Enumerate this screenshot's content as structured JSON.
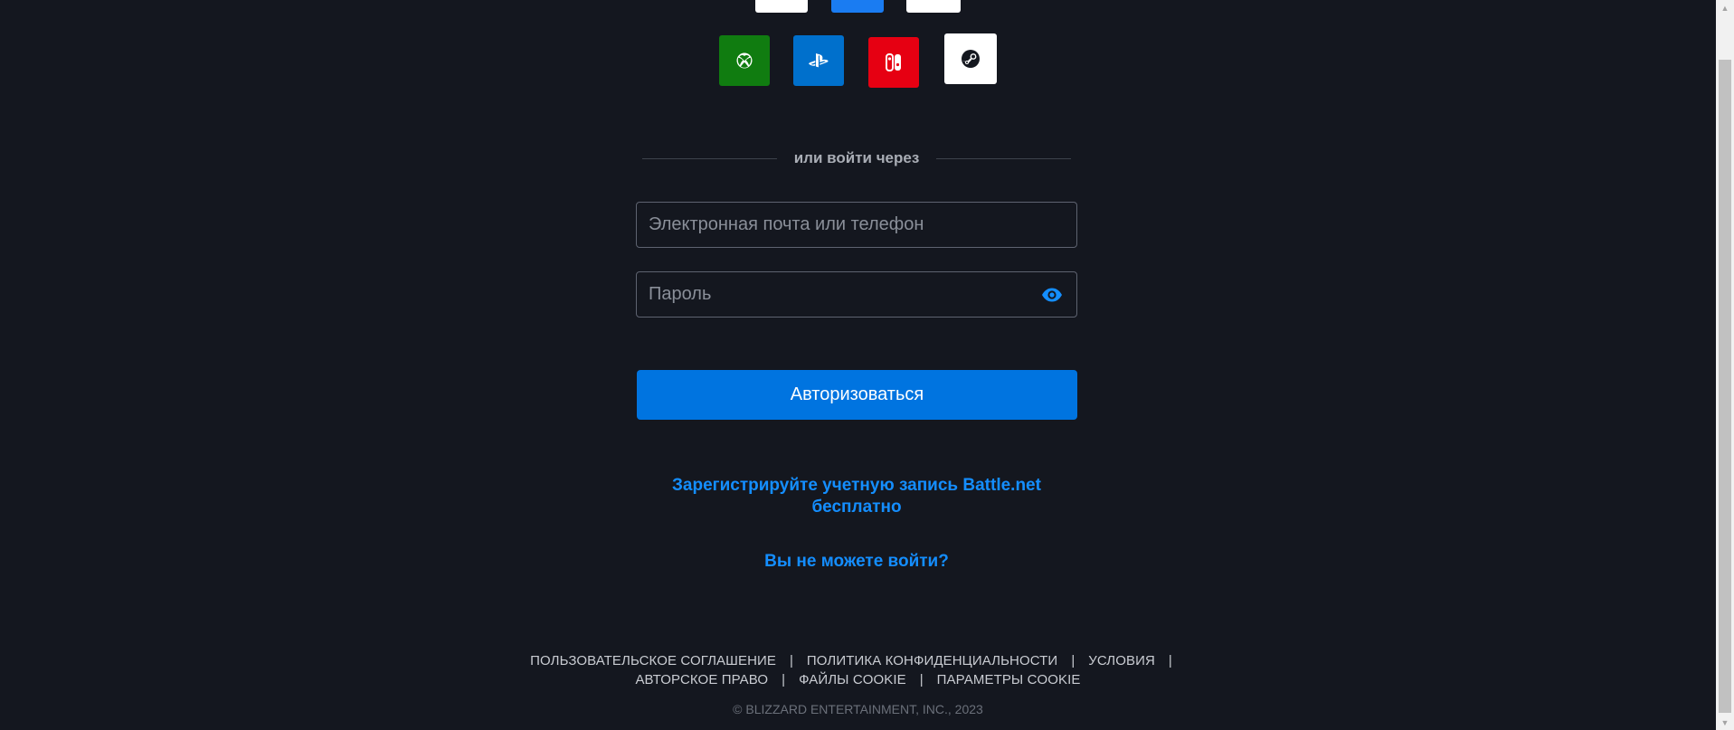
{
  "console_logins": {
    "xbox": {
      "icon": "xbox-icon",
      "color": "#107c10"
    },
    "playstation": {
      "icon": "playstation-icon",
      "color": "#0070cc"
    },
    "nintendo": {
      "icon": "nintendo-switch-icon",
      "color": "#e60012"
    },
    "steam": {
      "icon": "steam-icon",
      "color": "#ffffff"
    }
  },
  "divider_text": "или войти через",
  "email_field": {
    "placeholder": "Электронная почта или телефон",
    "value": ""
  },
  "password_field": {
    "placeholder": "Пароль",
    "value": "",
    "toggle_icon": "eye-icon"
  },
  "submit_label": "Авторизоваться",
  "register_link": {
    "line1": "Зарегистрируйте учетную запись Battle.net",
    "line2": "бесплатно"
  },
  "cant_login_link": "Вы не можете войти?",
  "footer": {
    "links_row1": [
      "ПОЛЬЗОВАТЕЛЬСКОЕ СОГЛАШЕНИЕ",
      "ПОЛИТИКА КОНФИДЕНЦИАЛЬНОСТИ",
      "УСЛОВИЯ"
    ],
    "links_row2": [
      "АВТОРСКОЕ ПРАВО",
      "ФАЙЛЫ COOKIE",
      "ПАРАМЕТРЫ COOKIE"
    ],
    "separator": "|",
    "copyright": "© BLIZZARD ENTERTAINMENT, INC., 2023"
  },
  "colors": {
    "background": "#14171f",
    "accent": "#0074e0",
    "link": "#148eff"
  }
}
